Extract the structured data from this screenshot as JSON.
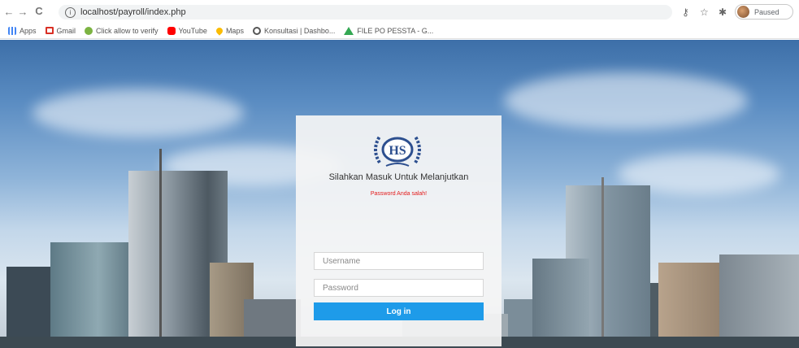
{
  "browser": {
    "url": "localhost/payroll/index.php",
    "profile_status": "Paused"
  },
  "bookmarks": [
    {
      "label": "Apps",
      "icon": "apps-grid-icon",
      "color": "#4285f4"
    },
    {
      "label": "Gmail",
      "icon": "gmail-icon",
      "color": "#d93025"
    },
    {
      "label": "Click allow to verify",
      "icon": "bookmark-favicon-icon",
      "color": "#7cb342"
    },
    {
      "label": "YouTube",
      "icon": "youtube-icon",
      "color": "#ff0000"
    },
    {
      "label": "Maps",
      "icon": "maps-pin-icon",
      "color": "#fbbc04"
    },
    {
      "label": "Konsultasi | Dashbo...",
      "icon": "bookmark-favicon-icon",
      "color": "#555555"
    },
    {
      "label": "FILE PO PESSTA - G...",
      "icon": "google-drive-icon",
      "color": "#34a853"
    }
  ],
  "login": {
    "logo_text": "HS",
    "welcome": "Silahkan Masuk Untuk Melanjutkan",
    "error": "Password Anda salah!",
    "username_placeholder": "Username",
    "password_placeholder": "Password",
    "login_label": "Log in",
    "accent_color": "#1e9be9",
    "error_color": "#e31b1b"
  }
}
